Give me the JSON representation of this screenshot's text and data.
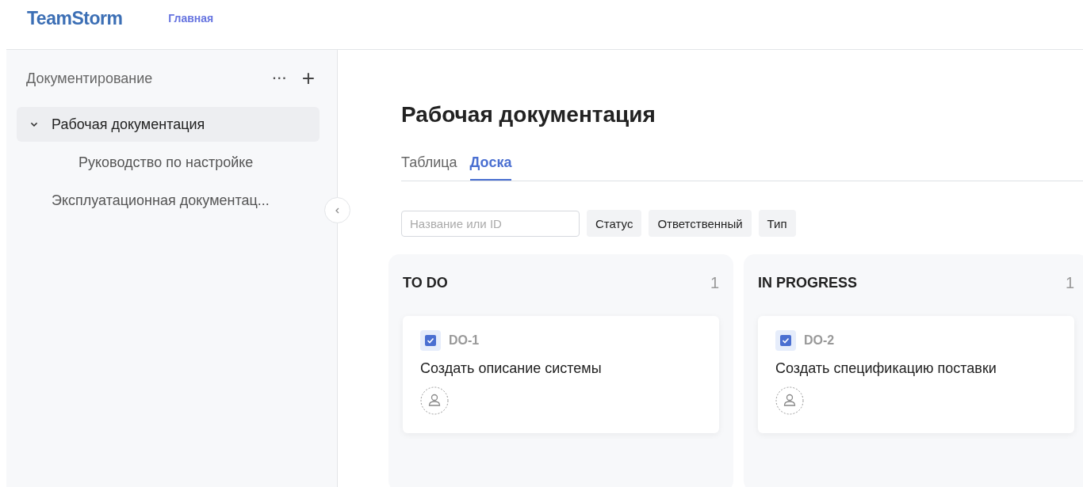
{
  "header": {
    "logo": "TeamStorm",
    "nav": [
      {
        "label": "Главная",
        "selected": true
      }
    ]
  },
  "sidebar": {
    "title": "Документирование",
    "more_button": "···",
    "add_button": "+",
    "items": [
      {
        "label": "Рабочая документация",
        "selected": true,
        "expanded": true,
        "children": [
          {
            "label": "Руководство по настройке",
            "selected": false
          }
        ]
      },
      {
        "label": "Эксплуатационная документац...",
        "selected": false
      }
    ]
  },
  "page": {
    "title": "Рабочая документация",
    "tabs": [
      {
        "label": "Таблица",
        "selected": false
      },
      {
        "label": "Доска",
        "selected": true
      }
    ],
    "search": {
      "placeholder": "Название или ID"
    },
    "filters": [
      "Статус",
      "Ответственный",
      "Тип"
    ],
    "columns": [
      {
        "title": "TO DO",
        "count": "1",
        "cards": [
          {
            "id": "DO-1",
            "title": "Создать описание системы",
            "done": true
          }
        ]
      },
      {
        "title": "IN PROGRESS",
        "count": "1",
        "cards": [
          {
            "id": "DO-2",
            "title": "Создать спецификацию поставки",
            "done": true
          }
        ]
      }
    ]
  }
}
